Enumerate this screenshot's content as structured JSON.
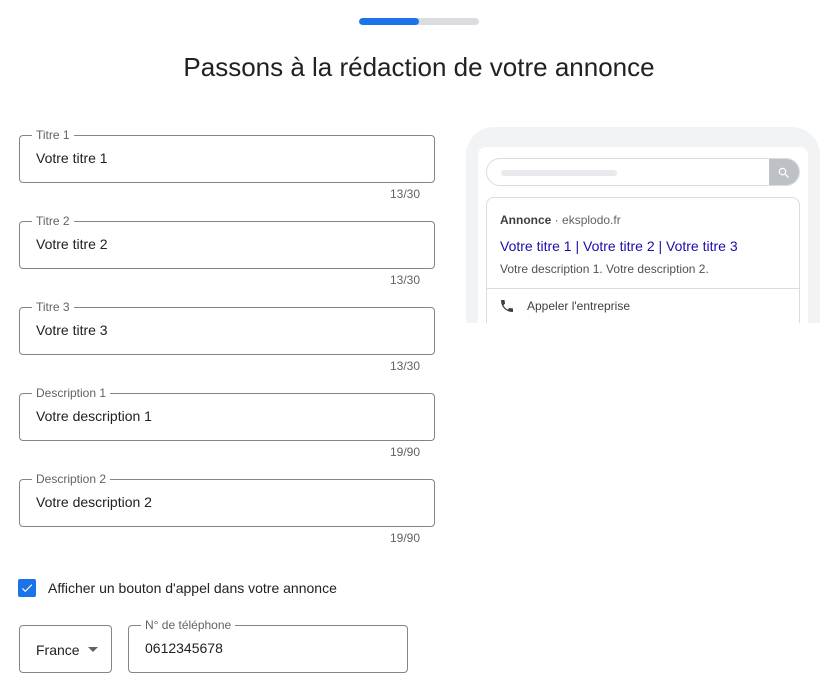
{
  "progress": {
    "fraction": 0.5
  },
  "page_title": "Passons à la rédaction de votre annonce",
  "fields": [
    {
      "label": "Titre 1",
      "value": "Votre titre 1",
      "counter": "13/30"
    },
    {
      "label": "Titre 2",
      "value": "Votre titre 2",
      "counter": "13/30"
    },
    {
      "label": "Titre 3",
      "value": "Votre titre 3",
      "counter": "13/30"
    },
    {
      "label": "Description 1",
      "value": "Votre description 1",
      "counter": "19/90"
    },
    {
      "label": "Description 2",
      "value": "Votre description 2",
      "counter": "19/90"
    }
  ],
  "call_checkbox": {
    "label": "Afficher un bouton d'appel dans votre annonce",
    "checked": true
  },
  "country_select": {
    "value": "France"
  },
  "phone": {
    "label": "N° de téléphone",
    "value": "0612345678"
  },
  "preview": {
    "badge": "Annonce",
    "separator": " · ",
    "domain": "eksplodo.fr",
    "headline": "Votre titre 1 | Votre titre 2 | Votre titre 3",
    "description": "Votre description 1. Votre description 2.",
    "call_label": "Appeler l'entreprise"
  },
  "icons": {
    "search": "search-icon",
    "phone": "phone-icon",
    "check": "check-icon",
    "dropdown": "dropdown-arrow-icon"
  },
  "colors": {
    "accent": "#1a73e8",
    "link": "#1a0dab",
    "border": "#80868b"
  }
}
